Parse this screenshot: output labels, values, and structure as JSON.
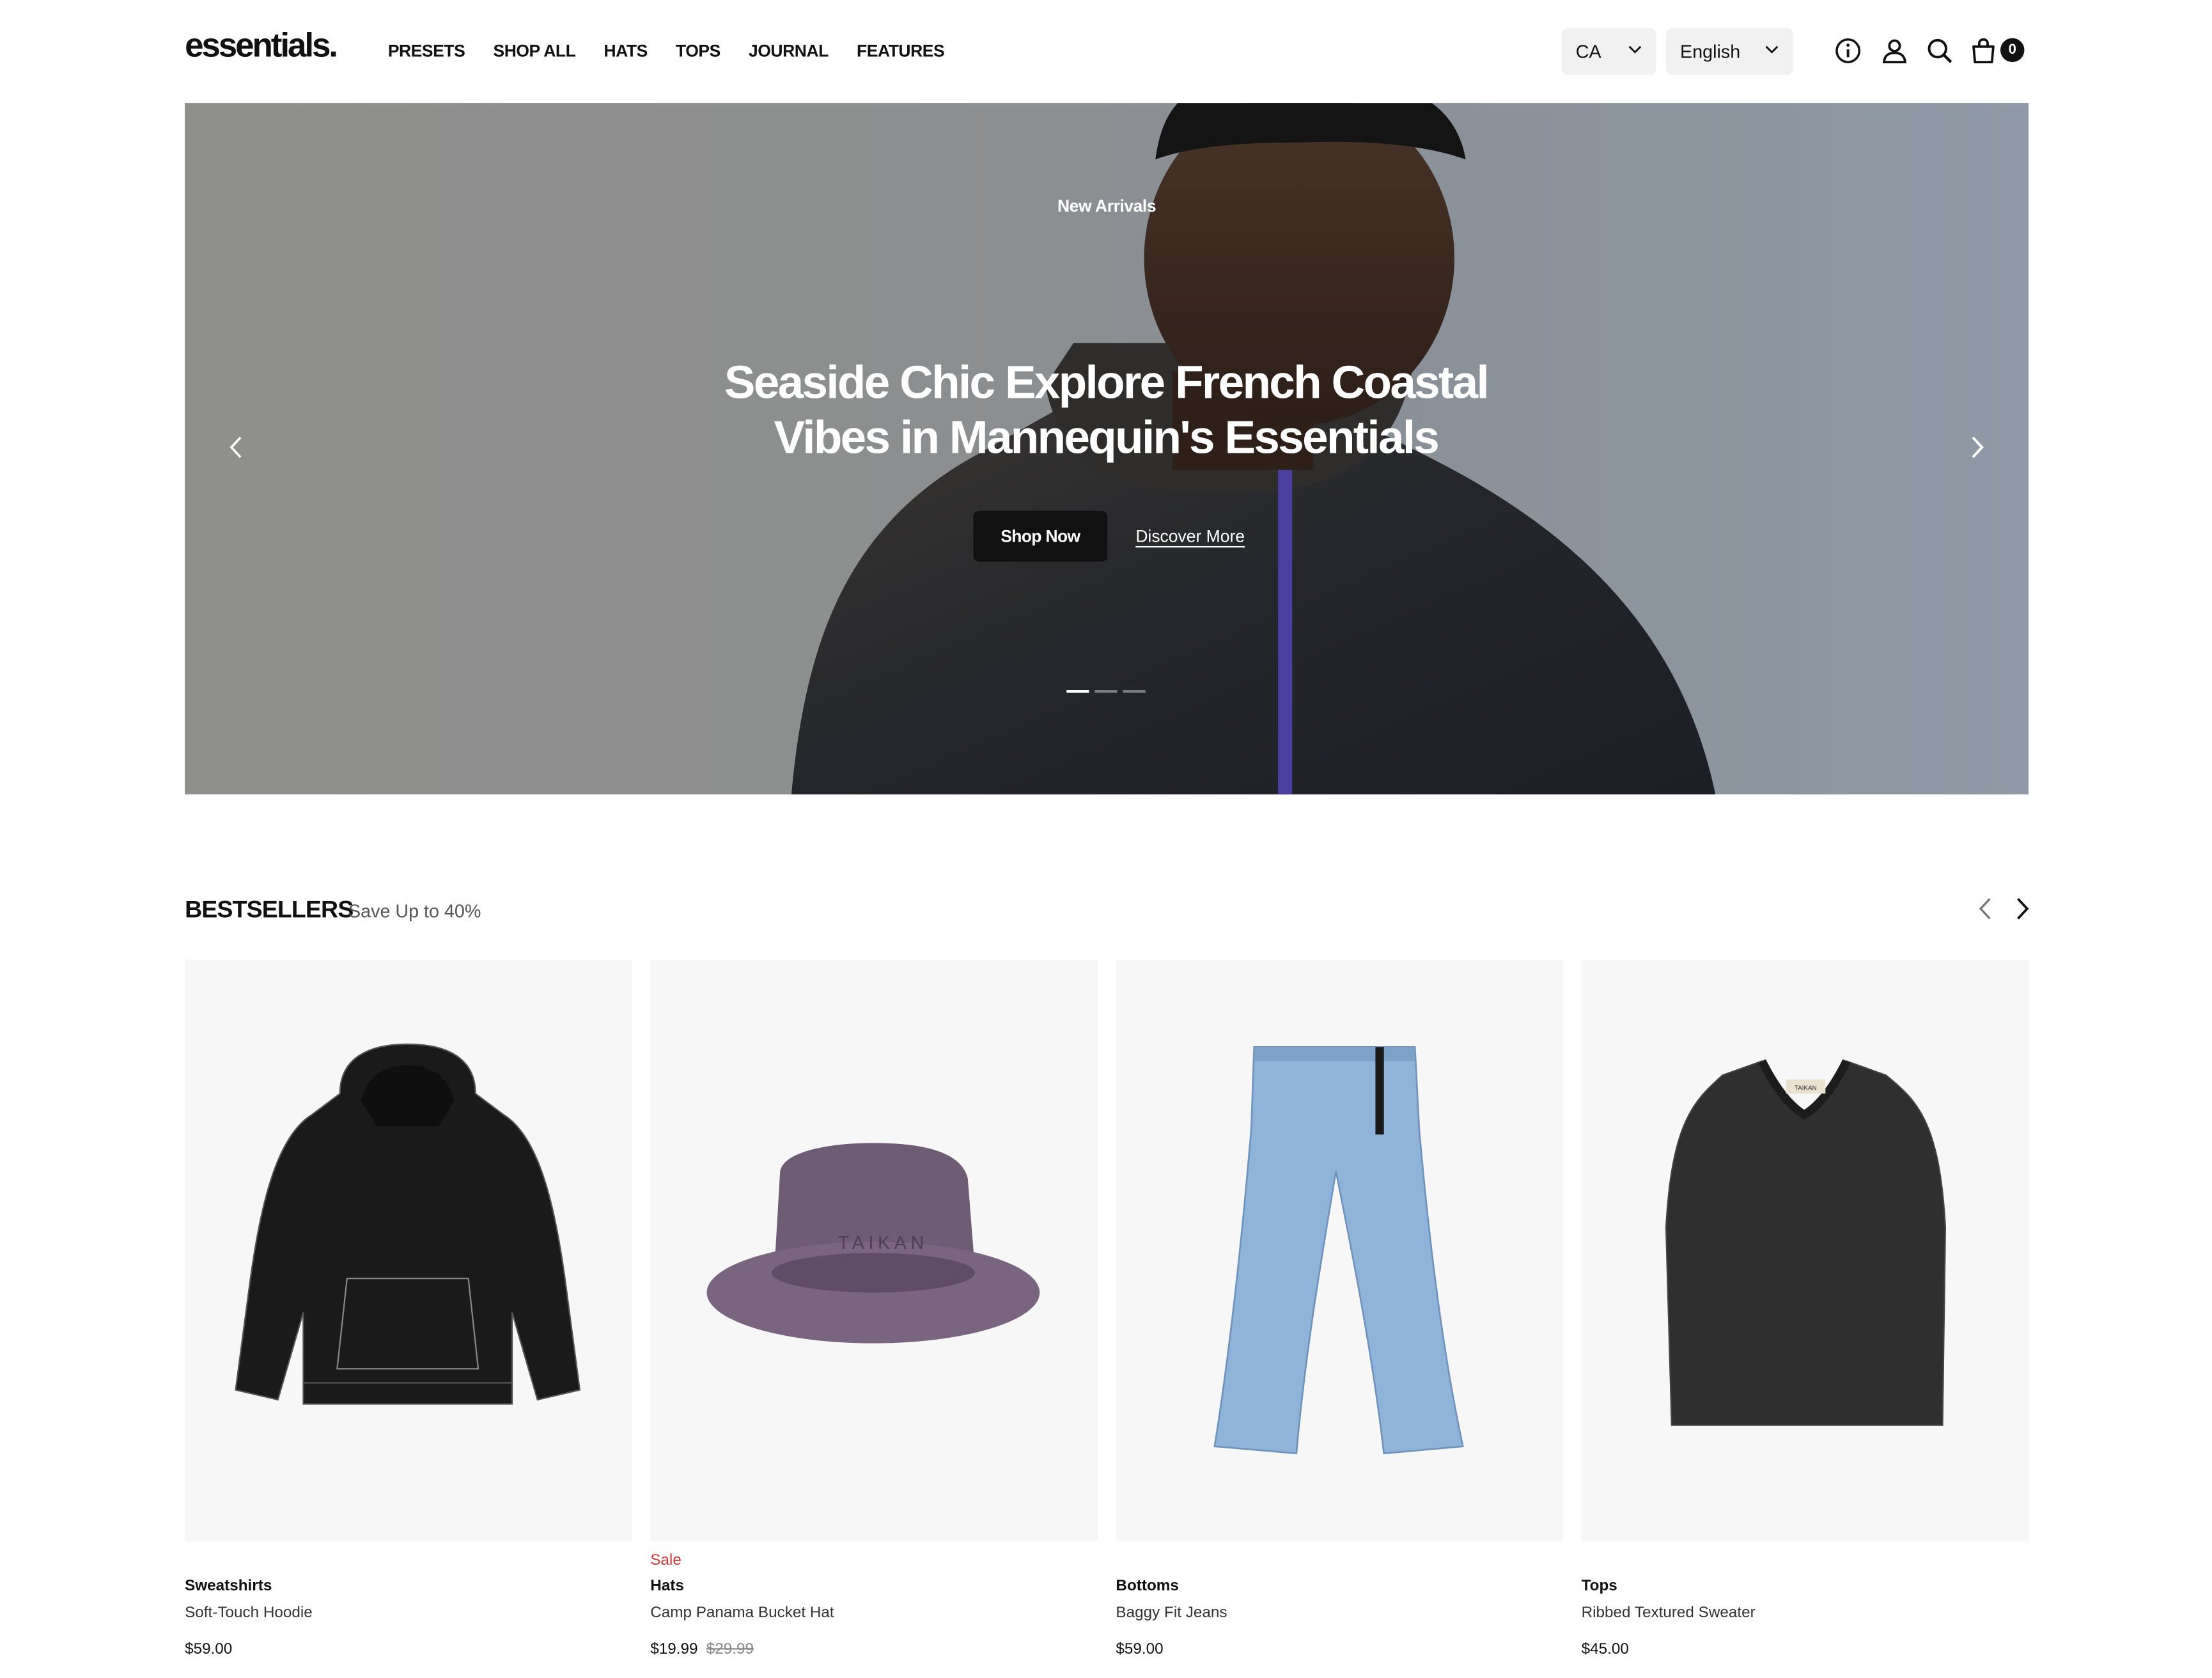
{
  "header": {
    "logo": "essentials.",
    "nav": [
      "PRESETS",
      "SHOP ALL",
      "HATS",
      "TOPS",
      "JOURNAL",
      "FEATURES"
    ],
    "country": "CA",
    "language": "English",
    "cart_count": "0",
    "icons": [
      "info-icon",
      "account-icon",
      "search-icon",
      "cart-icon"
    ]
  },
  "hero": {
    "eyebrow": "New Arrivals",
    "title": "Seaside Chic Explore French Coastal Vibes in Mannequin's Essentials",
    "primary_button": "Shop Now",
    "secondary_link": "Discover More",
    "slide_count": 3,
    "active_slide": 1
  },
  "bestsellers": {
    "title": "BESTSELLERS",
    "subtitle": "Save Up to 40%",
    "products": [
      {
        "category": "Sweatshirts",
        "name": "Soft-Touch Hoodie",
        "price": "$59.00",
        "sale": false
      },
      {
        "category": "Hats",
        "name": "Camp Panama Bucket Hat",
        "price": "$19.99",
        "old_price": "$29.99",
        "sale_label": "Sale",
        "sale": true,
        "image_text": "TAIKAN"
      },
      {
        "category": "Bottoms",
        "name": "Baggy Fit Jeans",
        "price": "$59.00",
        "sale": false
      },
      {
        "category": "Tops",
        "name": "Ribbed Textured Sweater",
        "price": "$45.00",
        "sale": false,
        "image_text": "TAIKAN"
      }
    ]
  },
  "colors": {
    "text": "#111111",
    "sale": "#d0393b",
    "card_bg": "#f7f7f7",
    "selector_bg": "#f1f1f1"
  }
}
